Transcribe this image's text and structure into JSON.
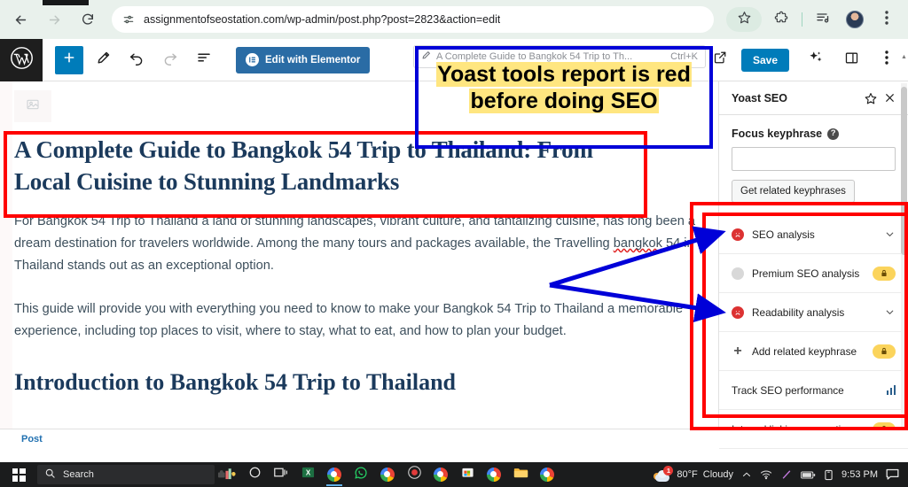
{
  "browser": {
    "url": "assignmentofseostation.com/wp-admin/post.php?post=2823&action=edit",
    "back_icon": "back-arrow-icon",
    "forward_icon": "forward-arrow-icon",
    "reload_icon": "reload-icon",
    "site_settings_icon": "site-settings-icon",
    "bookmark_icon": "star-icon",
    "extensions_icon": "extensions-puzzle-icon",
    "reading_list_icon": "reading-list-icon",
    "profile_icon": "profile-avatar-icon",
    "menu_icon": "three-dot-menu-icon"
  },
  "wp_toolbar": {
    "logo": "wordpress-logo-icon",
    "add_block": "add-block-plus-icon",
    "tools": "pencil-tools-icon",
    "undo": "undo-arrow-icon",
    "redo": "redo-arrow-icon",
    "list_view": "list-view-icon",
    "elementor_label": "Edit with Elementor",
    "elementor_mark": "elementor-logo-icon",
    "command_bar_text": "A Complete Guide to Bangkok 54 Trip to Th...",
    "command_bar_shortcut": "Ctrl+K",
    "command_bar_icon": "pencil-edit-icon",
    "view_icon": "desktop-view-icon",
    "preview_icon": "external-preview-icon",
    "save_label": "Save",
    "ai_icon": "ai-sparkle-icon",
    "settings_panel_icon": "settings-sidebar-icon",
    "options_icon": "three-dot-options-icon"
  },
  "post": {
    "featured_image_icon": "image-placeholder-icon",
    "title": "A Complete Guide to Bangkok 54 Trip to Thailand: From Local Cuisine to Stunning Landmarks",
    "paragraph_1_a": "For Bangkok 54 Trip to Thailand a land of stunning landscapes, vibrant culture, and tantalizing cuisine, has long been a dream destination for travelers worldwide. Among the many tours and packages available, the Travelling ",
    "paragraph_1_misspelled": "bangkok",
    "paragraph_1_b": " 54 in Thailand stands out as an exceptional option.",
    "paragraph_2": "This guide will provide you with everything you need to know to make your Bangkok 54 Trip to Thailand a memorable experience, including top places to visit, where to stay, what to eat, and how to plan your budget.",
    "heading_2": "Introduction to Bangkok 54 Trip to Thailand",
    "breadcrumb": "Post"
  },
  "yoast": {
    "panel_title": "Yoast SEO",
    "star_icon": "star-icon",
    "close_icon": "close-x-icon",
    "focus_keyphrase_label": "Focus keyphrase",
    "help_icon": "help-question-icon",
    "keyphrase_value": "",
    "keyphrase_placeholder": "",
    "related_keyphrases_button": "Get related keyphrases",
    "rows": [
      {
        "label": "SEO analysis",
        "status": "bad",
        "status_icon": "red-sad-face-icon",
        "right_icon": "chevron-down-icon"
      },
      {
        "label": "Premium SEO analysis",
        "status": "locked",
        "status_icon": "grey-circle-icon",
        "right_icon": "lock-badge-icon"
      },
      {
        "label": "Readability analysis",
        "status": "bad",
        "status_icon": "red-sad-face-icon",
        "right_icon": "chevron-down-icon"
      },
      {
        "label": "Add related keyphrase",
        "status": "locked",
        "status_icon": "plus-icon",
        "right_icon": "lock-badge-icon"
      },
      {
        "label": "Track SEO performance",
        "status": "none",
        "status_icon": "",
        "right_icon": "bar-chart-icon"
      }
    ],
    "partial_row": {
      "label": "Internal linking suggestions",
      "right_icon": "lock-badge-icon"
    }
  },
  "annotation": {
    "callout_line_1": "Yoast tools report is red",
    "callout_line_2": "before doing SEO",
    "highlight_color": "#ffe680",
    "box_color_blue": "#0000d8",
    "box_color_red": "#ff0000",
    "arrow_color": "#0000d8"
  },
  "taskbar": {
    "start_icon": "windows-start-icon",
    "search_placeholder": "Search",
    "search_icon": "search-icon",
    "cortana_icon": "cortana-circle-icon",
    "task_view_icon": "task-view-icon",
    "apps": [
      "excel-icon",
      "chrome-icon",
      "whatsapp-icon",
      "chrome-icon",
      "record-icon",
      "chrome-icon",
      "microsoft-store-icon",
      "chrome-icon",
      "file-explorer-icon",
      "chrome-icon"
    ],
    "weather_temp": "80°F",
    "weather_condition": "Cloudy",
    "weather_badge": "1",
    "tray_chevron_icon": "chevron-up-icon",
    "wifi_icon": "wifi-icon",
    "pen_icon": "pen-icon",
    "battery_icon": "battery-icon",
    "device_icon": "device-icon",
    "clock": "9:53 PM",
    "notifications_icon": "notifications-icon"
  }
}
